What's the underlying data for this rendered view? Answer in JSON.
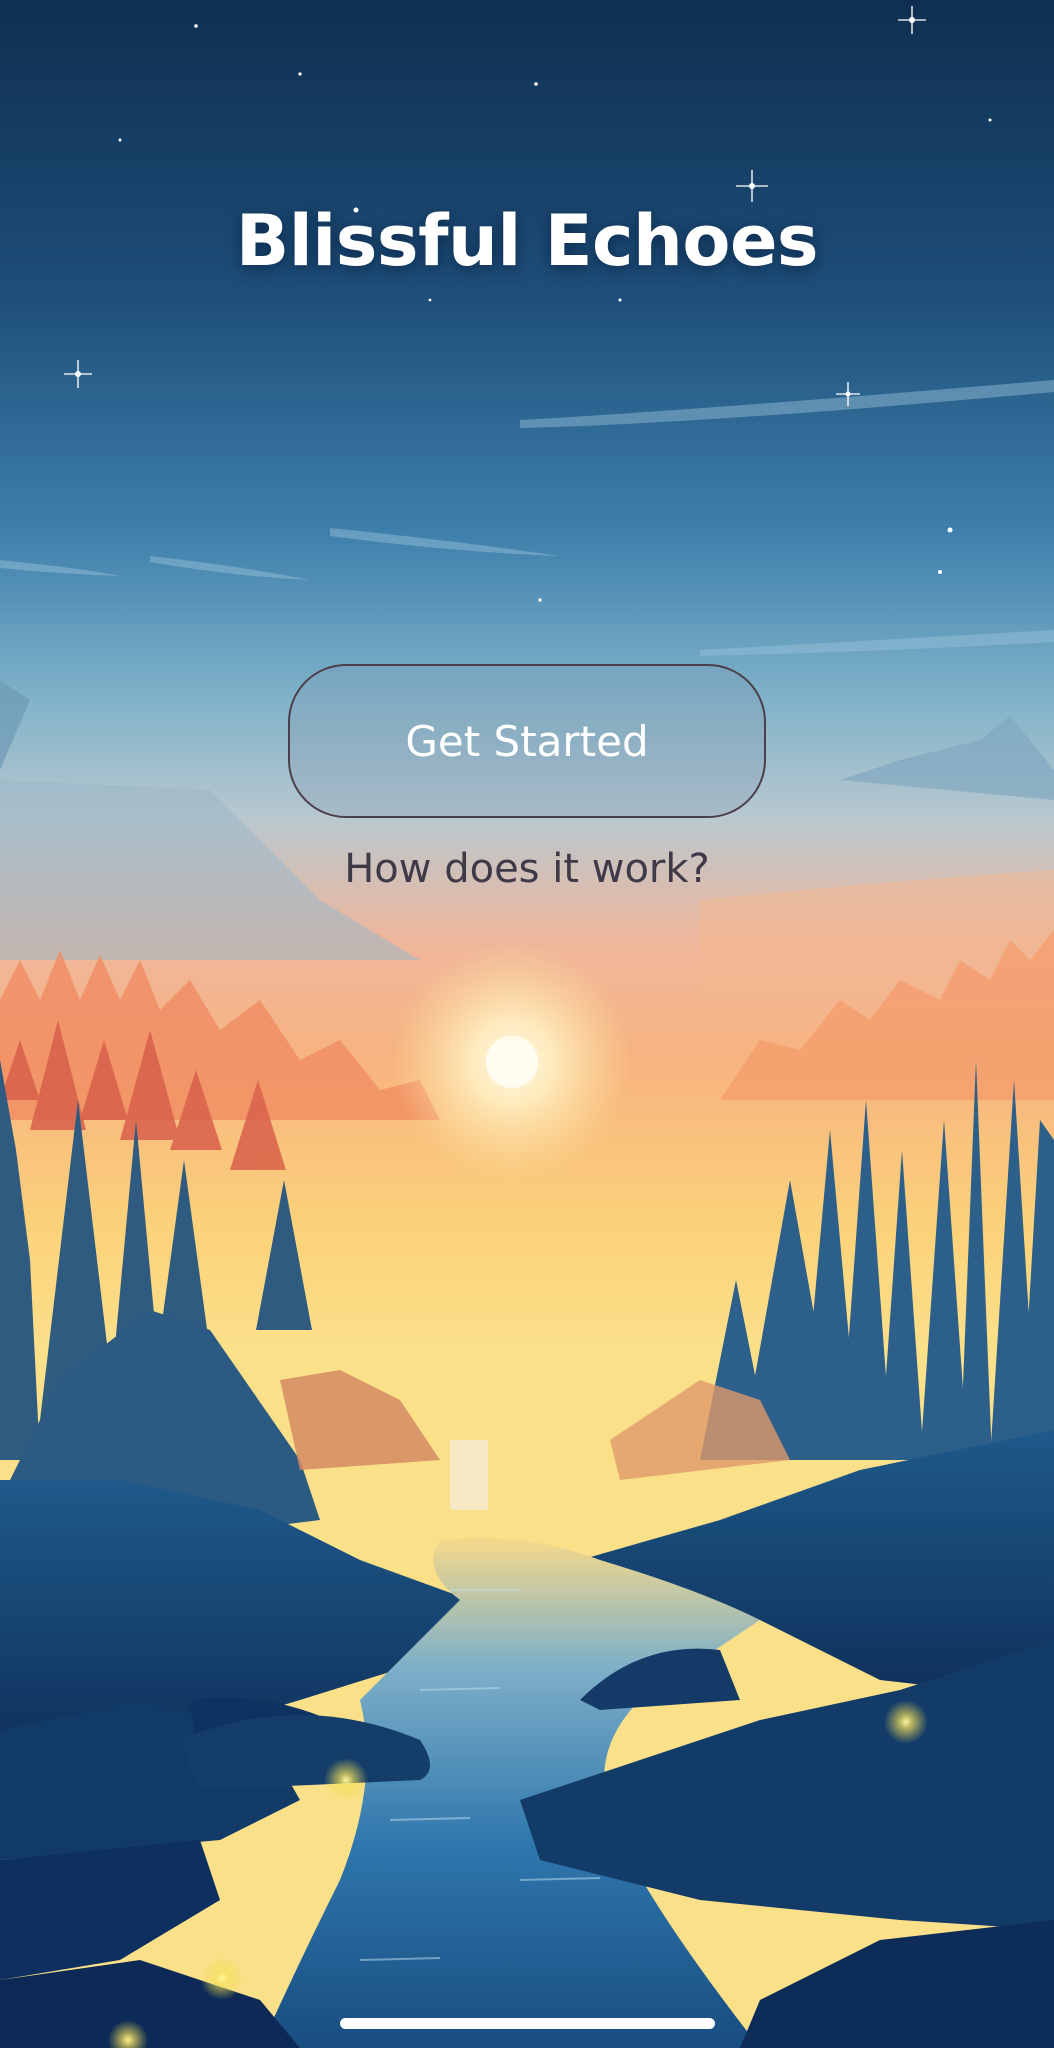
{
  "app": {
    "title": "Blissful Echoes"
  },
  "actions": {
    "primary_label": "Get Started",
    "secondary_label": "How does it work?"
  },
  "background": {
    "scene": "forest valley at sunset with river, starry sky, fireflies"
  },
  "colors": {
    "sky_top": "#123a5e",
    "sky_mid": "#4f8fb8",
    "sunset_glow": "#fbd37a",
    "forest_dark": "#163f6e",
    "water": "#1f6aa3",
    "button_border": "#4a3f4a",
    "link_text": "#3e3a48"
  }
}
